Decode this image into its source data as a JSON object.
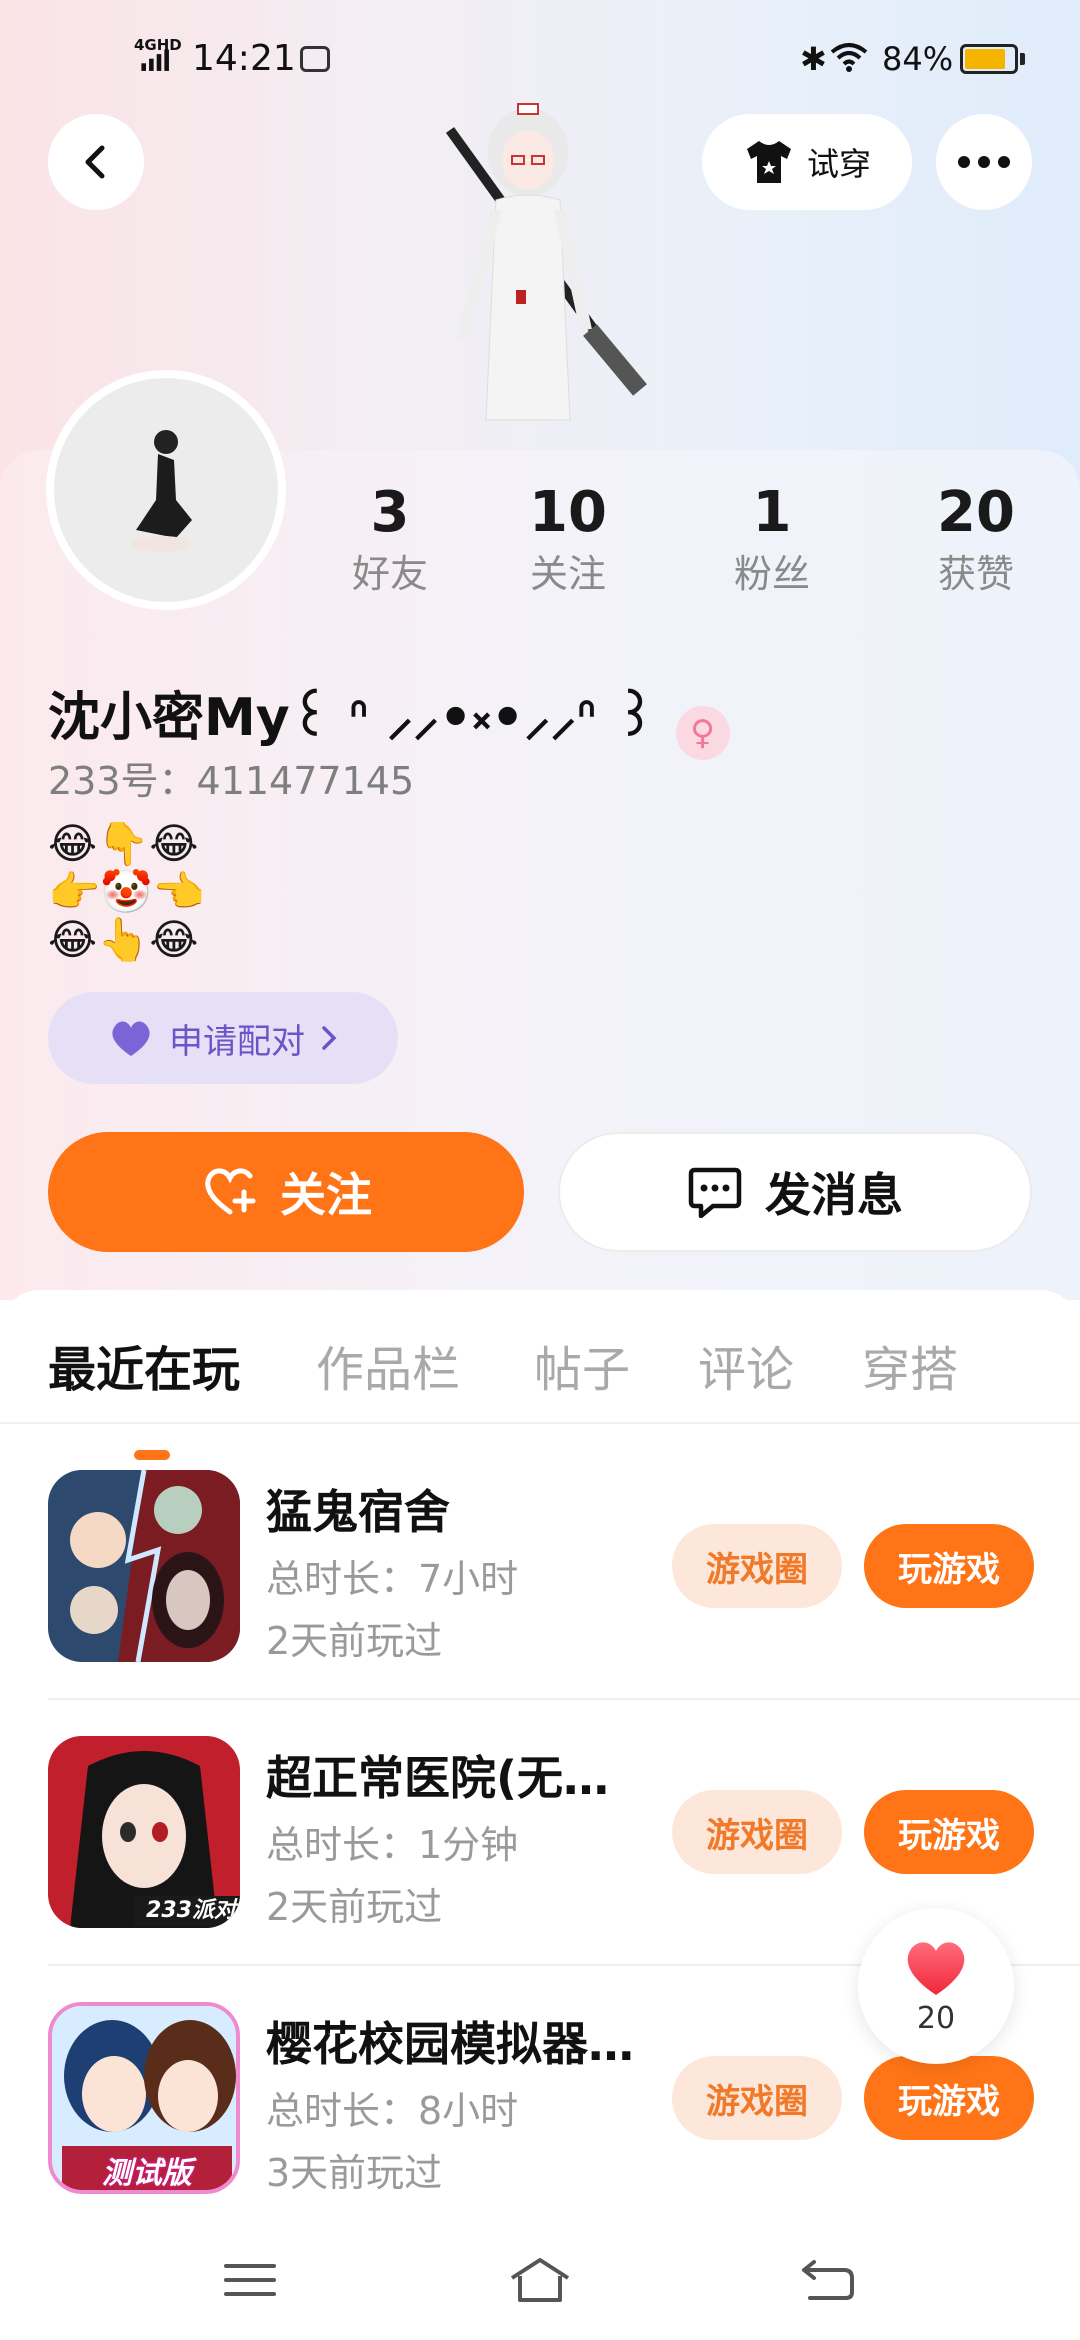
{
  "status_bar": {
    "network": "4GHD",
    "time": "14:21",
    "battery_percent": "84%",
    "battery_level": 0.84
  },
  "header": {
    "try_on_label": "试穿"
  },
  "profile": {
    "stats": [
      {
        "num": "3",
        "label": "好友"
      },
      {
        "num": "10",
        "label": "关注"
      },
      {
        "num": "1",
        "label": "粉丝"
      },
      {
        "num": "20",
        "label": "获赞"
      }
    ],
    "username": "沈小密My꒰ ᐢ ⸝⸝•༝•⸝⸝ᐢ ꒱",
    "gender_icon": "female-icon",
    "uid": "233号：411477145",
    "bio": "😂👇😂\n👉🤡👈\n😂👆😂",
    "match_label": "申请配对",
    "follow_label": "关注",
    "message_label": "发消息"
  },
  "tabs": [
    {
      "label": "最近在玩",
      "active": true
    },
    {
      "label": "作品栏",
      "active": false
    },
    {
      "label": "帖子",
      "active": false
    },
    {
      "label": "评论",
      "active": false
    },
    {
      "label": "穿搭",
      "active": false
    }
  ],
  "games": [
    {
      "name": "猛鬼宿舍",
      "duration": "总时长：7小时",
      "last_played": "2天前玩过",
      "circle_label": "游戏圈",
      "play_label": "玩游戏"
    },
    {
      "name": "超正常医院(无…",
      "duration": "总时长：1分钟",
      "last_played": "2天前玩过",
      "circle_label": "游戏圈",
      "play_label": "玩游戏",
      "icon_badge": "233派对"
    },
    {
      "name": "樱花校园模拟器…",
      "duration": "总时长：8小时",
      "last_played": "3天前玩过",
      "circle_label": "游戏圈",
      "play_label": "玩游戏",
      "icon_badge": "测试版"
    }
  ],
  "like_fab": {
    "count": "20"
  },
  "colors": {
    "accent": "#ff7416",
    "match_purple": "#6a55c6",
    "circle_tag_bg": "#fde7da"
  }
}
